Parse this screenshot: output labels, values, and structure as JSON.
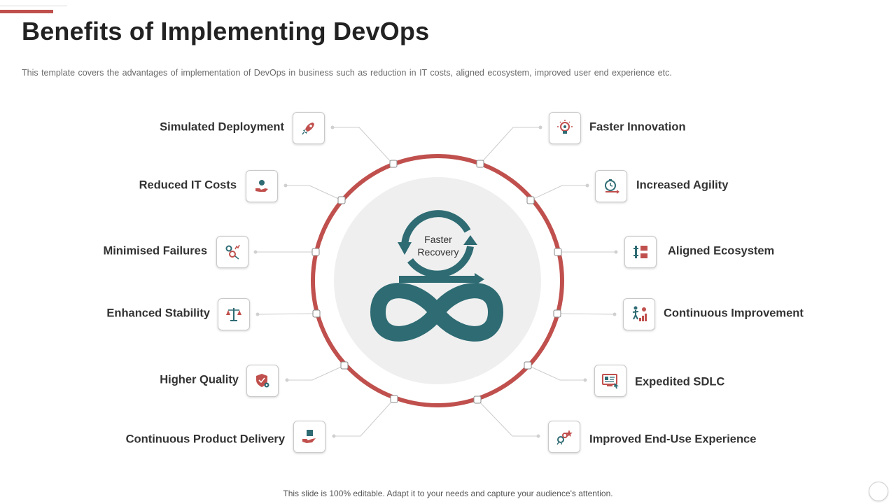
{
  "title": "Benefits of Implementing DevOps",
  "subtitle": "This template covers the advantages  of implementation of DevOps  in business such as reduction in IT  costs, aligned ecosystem, improved  user end experience etc.",
  "center": {
    "line1": "Faster",
    "line2": "Recovery"
  },
  "left_items": [
    {
      "label": "Simulated Deployment",
      "icon": "rocket-icon"
    },
    {
      "label": "Reduced IT Costs",
      "icon": "hand-coin-icon"
    },
    {
      "label": "Minimised Failures",
      "icon": "gears-chart-icon"
    },
    {
      "label": "Enhanced Stability",
      "icon": "balance-scale-icon"
    },
    {
      "label": "Higher Quality",
      "icon": "shield-gear-icon"
    },
    {
      "label": "Continuous Product Delivery",
      "icon": "hand-box-icon"
    }
  ],
  "right_items": [
    {
      "label": "Faster Innovation",
      "icon": "lightbulb-icon"
    },
    {
      "label": "Increased Agility",
      "icon": "stopwatch-arrow-icon"
    },
    {
      "label": "Aligned Ecosystem",
      "icon": "ecosystem-icon"
    },
    {
      "label": "Continuous Improvement",
      "icon": "person-steps-icon"
    },
    {
      "label": "Expedited SDLC",
      "icon": "monitor-cursor-icon"
    },
    {
      "label": "Improved End-Use Experience",
      "icon": "gears-star-icon"
    }
  ],
  "footer": "This slide is 100% editable. Adapt it to your needs and capture your audience's attention.",
  "colors": {
    "accent": "#c0504d",
    "teal": "#2e6b73",
    "dark": "#3a4a50"
  }
}
